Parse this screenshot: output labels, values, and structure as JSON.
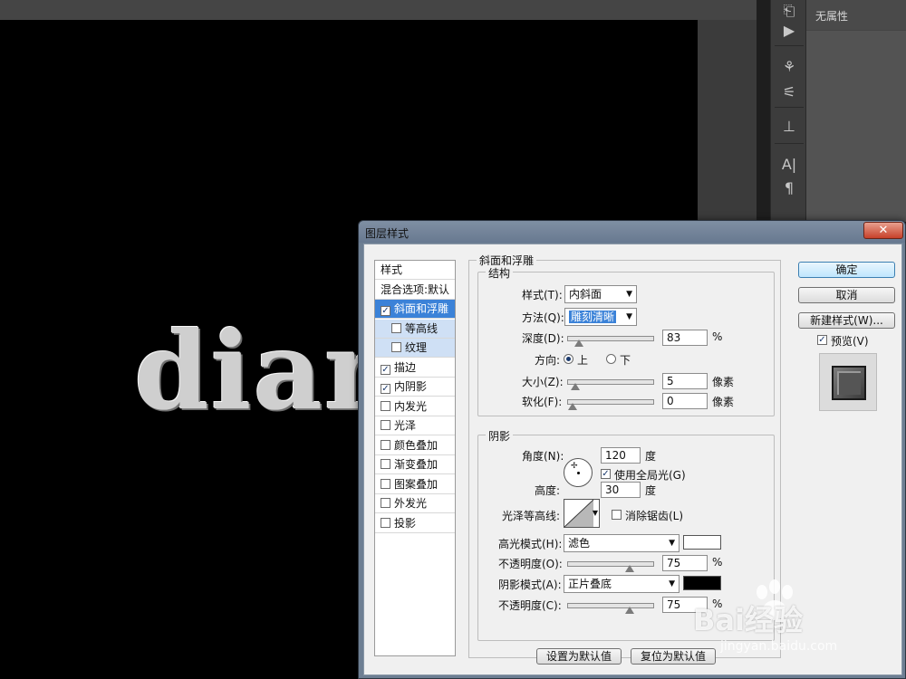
{
  "canvas": {
    "text": "diam"
  },
  "properties_panel": {
    "label": "无属性"
  },
  "dialog": {
    "title": "图层样式",
    "close_label": "✕",
    "styles_list": [
      {
        "label": "样式",
        "type": "header"
      },
      {
        "label": "混合选项:默认",
        "type": "header"
      },
      {
        "label": "斜面和浮雕",
        "checked": true,
        "active": true
      },
      {
        "label": "等高线",
        "checked": false,
        "sub": true
      },
      {
        "label": "纹理",
        "checked": false,
        "sub": true
      },
      {
        "label": "描边",
        "checked": true
      },
      {
        "label": "内阴影",
        "checked": true
      },
      {
        "label": "内发光",
        "checked": false
      },
      {
        "label": "光泽",
        "checked": false
      },
      {
        "label": "颜色叠加",
        "checked": false
      },
      {
        "label": "渐变叠加",
        "checked": false
      },
      {
        "label": "图案叠加",
        "checked": false
      },
      {
        "label": "外发光",
        "checked": false
      },
      {
        "label": "投影",
        "checked": false
      }
    ],
    "bevel": {
      "title": "斜面和浮雕",
      "structure": {
        "title": "结构",
        "style_label": "样式(T):",
        "style_value": "内斜面",
        "technique_label": "方法(Q):",
        "technique_value": "雕刻清晰",
        "depth_label": "深度(D):",
        "depth_value": "83",
        "depth_level": 0.08,
        "depth_unit": "%",
        "direction_label": "方向:",
        "direction_up": "上",
        "direction_down": "下",
        "size_label": "大小(Z):",
        "size_value": "5",
        "size_level": 0.04,
        "size_unit": "像素",
        "soften_label": "软化(F):",
        "soften_value": "0",
        "soften_level": 0.0,
        "soften_unit": "像素"
      },
      "shading": {
        "title": "阴影",
        "angle_label": "角度(N):",
        "angle_value": "120",
        "angle_unit": "度",
        "global_light_label": "使用全局光(G)",
        "altitude_label": "高度:",
        "altitude_value": "30",
        "altitude_unit": "度",
        "gloss_contour_label": "光泽等高线:",
        "anti_aliased_label": "消除锯齿(L)",
        "highlight_mode_label": "高光模式(H):",
        "highlight_mode_value": "滤色",
        "highlight_color": "#ffffff",
        "highlight_opacity_label": "不透明度(O):",
        "highlight_opacity_value": "75",
        "highlight_opacity_level": 0.75,
        "shadow_mode_label": "阴影模式(A):",
        "shadow_mode_value": "正片叠底",
        "shadow_color": "#000000",
        "shadow_opacity_label": "不透明度(C):",
        "shadow_opacity_value": "75",
        "shadow_opacity_level": 0.75,
        "percent": "%"
      },
      "make_default_label": "设置为默认值",
      "reset_default_label": "复位为默认值"
    },
    "ok_label": "确定",
    "cancel_label": "取消",
    "new_style_label": "新建样式(W)...",
    "preview_label": "预览(V)"
  },
  "watermark": {
    "brand": "Bai经验",
    "url": "jingyan.baidu.com"
  }
}
